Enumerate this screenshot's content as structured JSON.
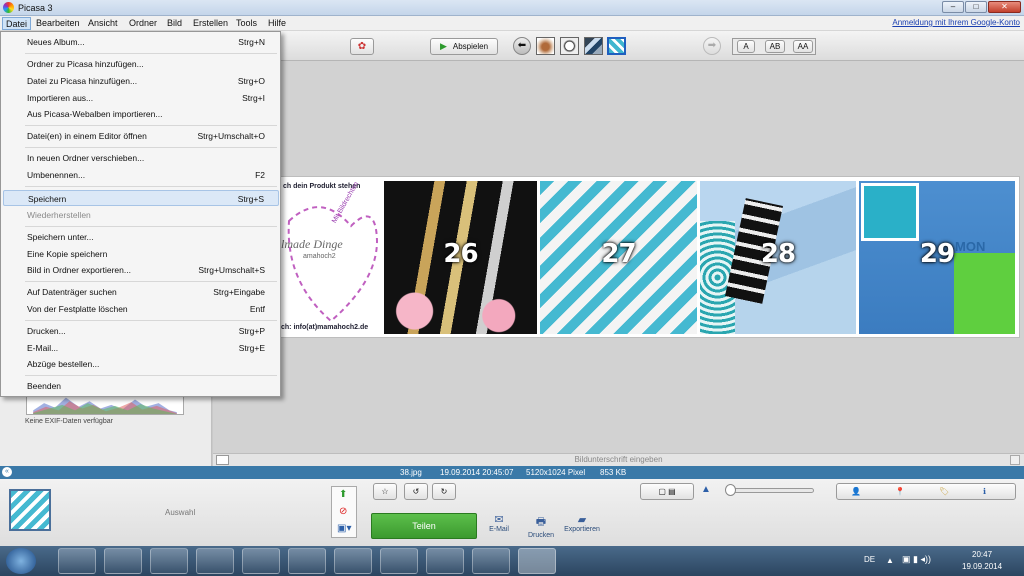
{
  "window": {
    "title": "Picasa 3",
    "controls": [
      "–",
      "□",
      "✕"
    ]
  },
  "menubar": {
    "items": [
      "Datei",
      "Bearbeiten",
      "Ansicht",
      "Ordner",
      "Bild",
      "Erstellen",
      "Tools",
      "Hilfe"
    ],
    "signin": "Anmeldung mit Ihrem Google-Konto"
  },
  "toolbar": {
    "play_label": "Abspielen",
    "caption_buttons": [
      "A",
      "AB",
      "AA"
    ]
  },
  "file_menu": {
    "items": [
      {
        "label": "Neues Album...",
        "shortcut": "Strg+N"
      },
      {
        "label": "Ordner zu Picasa hinzufügen...",
        "shortcut": ""
      },
      {
        "label": "Datei zu Picasa hinzufügen...",
        "shortcut": "Strg+O"
      },
      {
        "label": "Importieren aus...",
        "shortcut": "Strg+I"
      },
      {
        "label": "Aus Picasa-Webalben importieren...",
        "shortcut": ""
      },
      {
        "label": "Datei(en) in einem Editor öffnen",
        "shortcut": "Strg+Umschalt+O"
      },
      {
        "label": "In neuen Ordner verschieben...",
        "shortcut": ""
      },
      {
        "label": "Umbenennen...",
        "shortcut": "F2"
      },
      {
        "label": "Speichern",
        "shortcut": "Strg+S"
      },
      {
        "label": "Wiederherstellen",
        "shortcut": ""
      },
      {
        "label": "Speichern unter...",
        "shortcut": ""
      },
      {
        "label": "Eine Kopie speichern",
        "shortcut": ""
      },
      {
        "label": "Bild in Ordner exportieren...",
        "shortcut": "Strg+Umschalt+S"
      },
      {
        "label": "Auf Datenträger suchen",
        "shortcut": "Strg+Eingabe"
      },
      {
        "label": "Von der Festplatte löschen",
        "shortcut": "Entf"
      },
      {
        "label": "Drucken...",
        "shortcut": "Strg+P"
      },
      {
        "label": "E-Mail...",
        "shortcut": "Strg+E"
      },
      {
        "label": "Abzüge bestellen...",
        "shortcut": ""
      },
      {
        "label": "Beenden",
        "shortcut": ""
      }
    ]
  },
  "left_panel": {
    "exif_text": "Keine EXIF-Daten verfügbar"
  },
  "strip": {
    "tiles": [
      {
        "number": "",
        "text_top": "ch dein Produkt stehen",
        "text_mid": "lmade Dinge",
        "text_sub": "amahoch2",
        "text_diag": "Mit Bildrechten versehen",
        "text_bottom": "ch: info(at)mamahoch2.de"
      },
      {
        "number": "26"
      },
      {
        "number": "27"
      },
      {
        "number": "28"
      },
      {
        "number": "29",
        "overlay_text": "MON"
      }
    ]
  },
  "caption": {
    "placeholder": "Bildunterschrift eingeben"
  },
  "status": {
    "filename": "38.jpg",
    "datetime": "19.09.2014 20:45:07",
    "dimensions": "5120x1024 Pixel",
    "size": "853 KB"
  },
  "bottom": {
    "selection_label": "Auswahl",
    "share_label": "Teilen",
    "email_label": "E-Mail",
    "print_label": "Drucken",
    "export_label": "Exportieren"
  },
  "taskbar": {
    "lang": "DE",
    "time": "20:47",
    "date": "19.09.2014"
  },
  "colors": {
    "status_bar": "#3a79a8",
    "share_button": "#3c9a2f",
    "menu_highlight": "#dbe8f7",
    "link": "#1a3fb0"
  }
}
